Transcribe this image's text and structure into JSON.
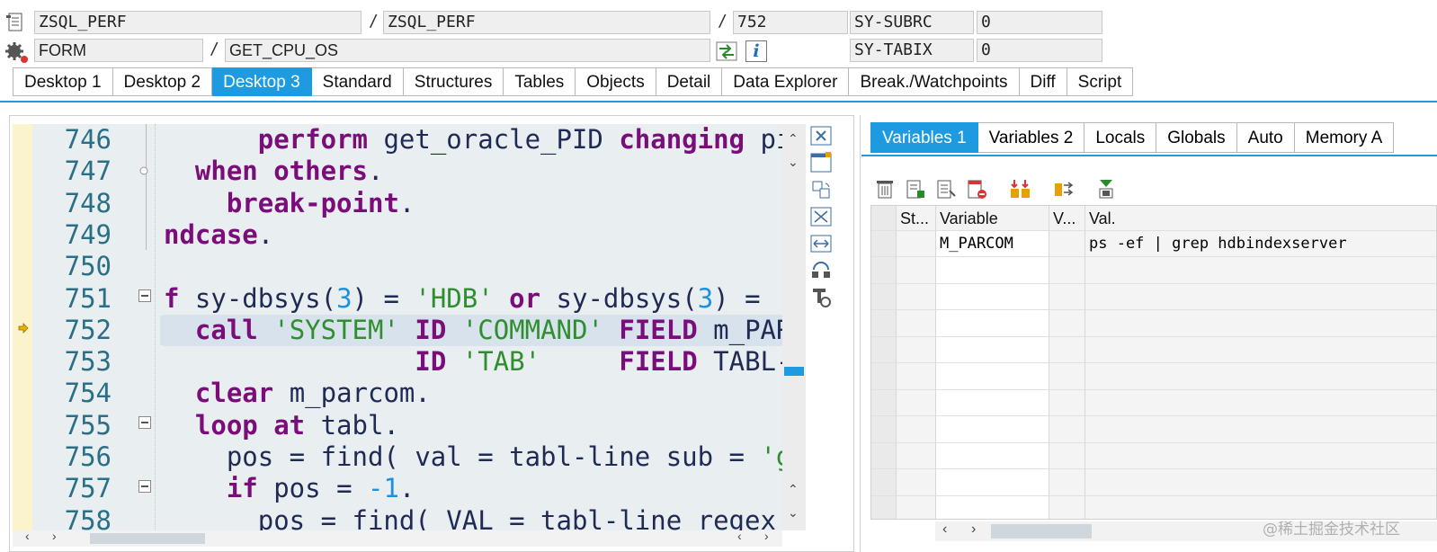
{
  "header": {
    "row1": {
      "program": "ZSQL_PERF",
      "include": "ZSQL_PERF",
      "line": "752",
      "sys_label": "SY-SUBRC",
      "sys_value": "0"
    },
    "row2": {
      "type": "FORM",
      "name": "GET_CPU_OS",
      "sys_label": "SY-TABIX",
      "sys_value": "0"
    },
    "separator": "/",
    "info_icon_text": "i"
  },
  "tabs": [
    "Desktop 1",
    "Desktop 2",
    "Desktop 3",
    "Standard",
    "Structures",
    "Tables",
    "Objects",
    "Detail",
    "Data Explorer",
    "Break./Watchpoints",
    "Diff",
    "Script"
  ],
  "active_tab": "Desktop 3",
  "code": {
    "current_line": "752",
    "lines": [
      {
        "n": "746",
        "parts": [
          [
            "      ",
            ""
          ],
          [
            "perform",
            "kw"
          ],
          [
            " get_oracle_PID ",
            "id"
          ],
          [
            "changing",
            "kw"
          ],
          [
            " pid",
            "id"
          ]
        ]
      },
      {
        "n": "747",
        "parts": [
          [
            "  ",
            ""
          ],
          [
            "when others",
            "kw"
          ],
          [
            ".",
            "id"
          ]
        ]
      },
      {
        "n": "748",
        "parts": [
          [
            "    ",
            ""
          ],
          [
            "break-point",
            "kw"
          ],
          [
            ".",
            "id"
          ]
        ]
      },
      {
        "n": "749",
        "parts": [
          [
            "ndcase",
            "kw"
          ],
          [
            ".",
            "id"
          ]
        ]
      },
      {
        "n": "750",
        "parts": []
      },
      {
        "n": "751",
        "parts": [
          [
            "f",
            "kw"
          ],
          [
            " sy-dbsys(",
            "id"
          ],
          [
            "3",
            "num"
          ],
          [
            ") = ",
            "id"
          ],
          [
            "'HDB'",
            "str"
          ],
          [
            " ",
            "id"
          ],
          [
            "or",
            "kw"
          ],
          [
            " sy-dbsys(",
            "id"
          ],
          [
            "3",
            "num"
          ],
          [
            ") =",
            "id"
          ]
        ]
      },
      {
        "n": "752",
        "parts": [
          [
            "  ",
            ""
          ],
          [
            "call",
            "kw"
          ],
          [
            " ",
            "id"
          ],
          [
            "'SYSTEM'",
            "str"
          ],
          [
            " ",
            "id"
          ],
          [
            "ID",
            "kw"
          ],
          [
            " ",
            "id"
          ],
          [
            "'COMMAND'",
            "str"
          ],
          [
            " ",
            "id"
          ],
          [
            "FIELD",
            "kw"
          ],
          [
            " m_PAR",
            "id"
          ]
        ]
      },
      {
        "n": "753",
        "parts": [
          [
            "                ",
            ""
          ],
          [
            "ID",
            "kw"
          ],
          [
            " ",
            "id"
          ],
          [
            "'TAB'",
            "str"
          ],
          [
            "     ",
            "id"
          ],
          [
            "FIELD",
            "kw"
          ],
          [
            " TABL-",
            "id"
          ]
        ]
      },
      {
        "n": "754",
        "parts": [
          [
            "  ",
            ""
          ],
          [
            "clear",
            "kw"
          ],
          [
            " m_parcom.",
            "id"
          ]
        ]
      },
      {
        "n": "755",
        "parts": [
          [
            "  ",
            ""
          ],
          [
            "loop at",
            "kw"
          ],
          [
            " tabl.",
            "id"
          ]
        ]
      },
      {
        "n": "756",
        "parts": [
          [
            "    pos = find( val = tabl-line sub = ",
            "id"
          ],
          [
            "'g",
            "str"
          ]
        ]
      },
      {
        "n": "757",
        "parts": [
          [
            "    ",
            ""
          ],
          [
            "if",
            "kw"
          ],
          [
            " pos = ",
            "id"
          ],
          [
            "-1",
            "num"
          ],
          [
            ".",
            "id"
          ]
        ]
      },
      {
        "n": "758",
        "parts": [
          [
            "      pos = find( VAL = tabl-line regex",
            "id"
          ]
        ]
      }
    ]
  },
  "variables_panel": {
    "tabs": [
      "Variables 1",
      "Variables 2",
      "Locals",
      "Globals",
      "Auto",
      "Memory A"
    ],
    "active_tab": "Variables 1",
    "toolbar_icons": [
      "trash-icon",
      "insert-row-icon",
      "text-list-icon",
      "delete-row-icon",
      "compare-icon",
      "transfer-icon",
      "download-icon"
    ],
    "columns": [
      "St...",
      "Variable",
      "V...",
      "Val."
    ],
    "rows": [
      {
        "status": "",
        "variable": "M_PARCOM",
        "v": "",
        "value": "ps -ef | grep hdbindexserver"
      }
    ]
  },
  "watermark": "@稀土掘金技术社区",
  "colors": {
    "accent": "#1e9be0",
    "keyword": "#7a0d7a",
    "string": "#2f8f2f",
    "number": "#1e90e0",
    "code_bg": "#e9eef1",
    "gutter": "#faf3cc"
  }
}
